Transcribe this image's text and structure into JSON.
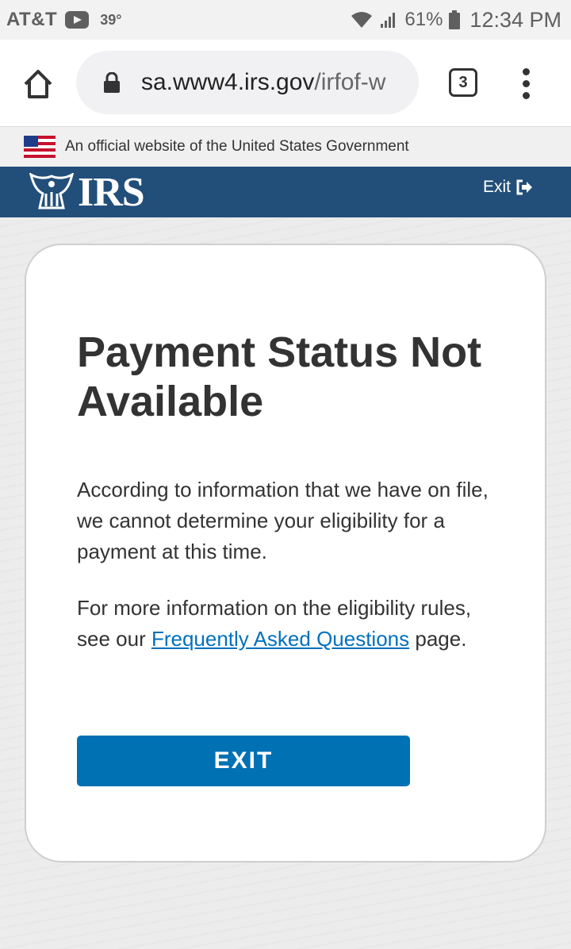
{
  "status_bar": {
    "carrier": "AT&T",
    "temperature": "39°",
    "battery_pct": "61%",
    "time": "12:34 PM",
    "icons": [
      "youtube-icon",
      "wifi-icon",
      "signal-icon",
      "battery-icon"
    ]
  },
  "browser": {
    "url_host": "sa.www4.irs.gov",
    "url_path": "/irfof-w",
    "tab_count": "3",
    "icons": [
      "home-icon",
      "lock-icon",
      "tabs-icon",
      "menu-dots-icon"
    ]
  },
  "gov_banner": {
    "text": "An official website of the United States Government"
  },
  "header": {
    "logo_text": "IRS",
    "exit_label": "Exit",
    "color": "#224f7a"
  },
  "main": {
    "title": "Payment Status Not Available",
    "paragraph1": "According to information that we have on file, we cannot determine your eligibility for a payment at this time.",
    "paragraph2_before": "For more information on the eligibility rules, see our ",
    "faq_link": "Frequently Asked Questions",
    "paragraph2_after": " page.",
    "exit_button": "EXIT",
    "button_color": "#0071b3",
    "link_color": "#0071bc"
  }
}
